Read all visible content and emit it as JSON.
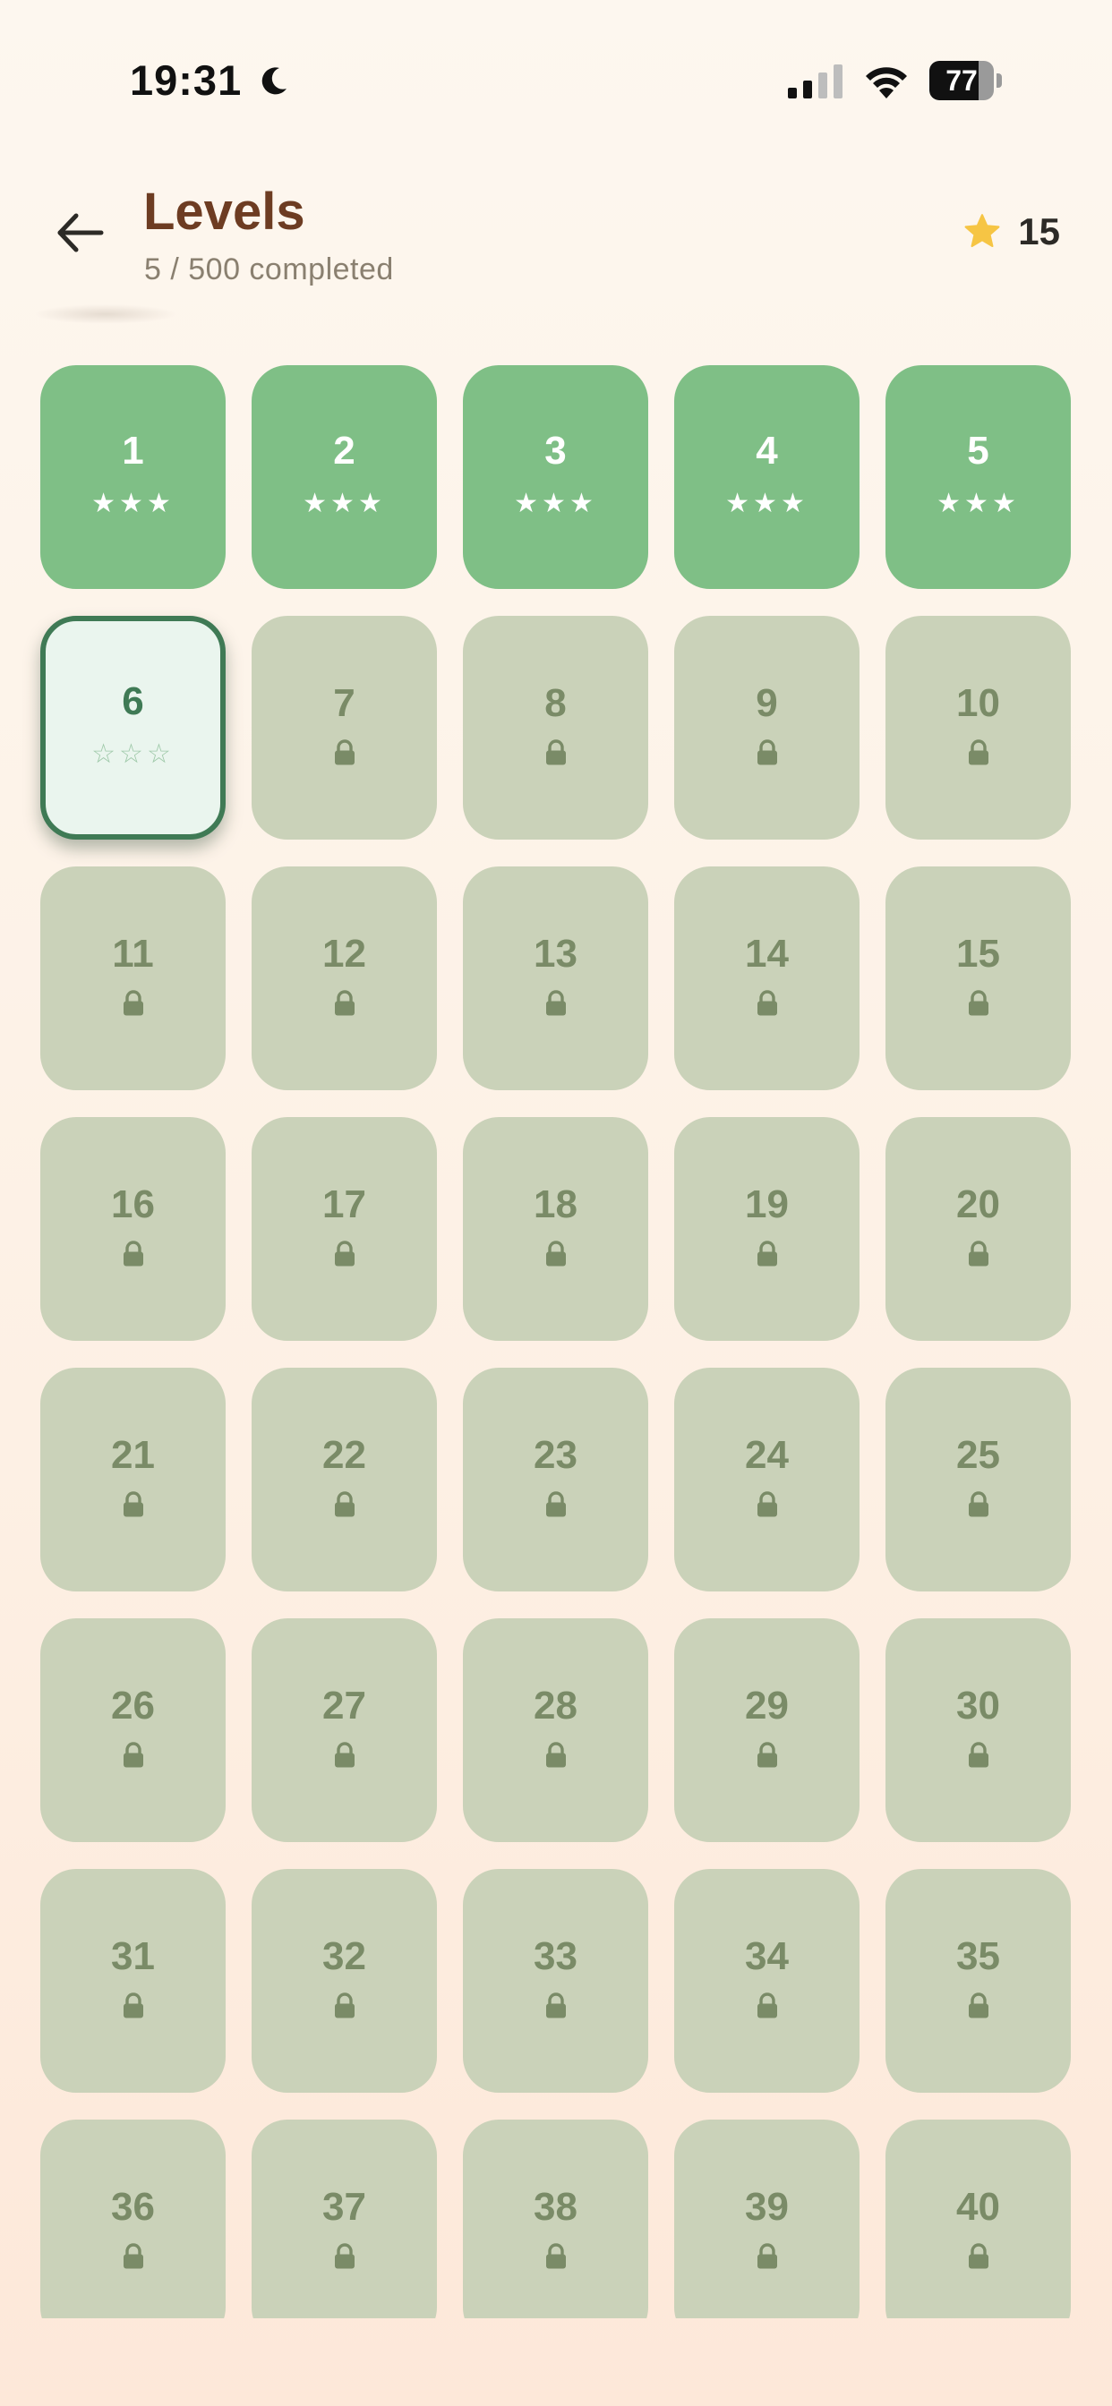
{
  "status_bar": {
    "time": "19:31",
    "battery_level": "77",
    "battery_fraction": 0.77,
    "icons": [
      "moon-icon",
      "signal-icon",
      "wifi-icon",
      "battery-icon"
    ]
  },
  "header": {
    "title": "Levels",
    "subtitle": "5 / 500 completed",
    "star_total": "15",
    "back_icon": "arrow-left-icon",
    "star_icon": "star-icon"
  },
  "colors": {
    "title": "#6d3c22",
    "completed_tile": "#7fbf86",
    "current_tile_bg": "#eaf5ee",
    "current_tile_border": "#3f7a55",
    "locked_tile": "#cad2b9",
    "locked_text": "#7a8b67",
    "star_gold": "#f6c544"
  },
  "levels": [
    {
      "number": "1",
      "state": "completed",
      "stars": "★★★"
    },
    {
      "number": "2",
      "state": "completed",
      "stars": "★★★"
    },
    {
      "number": "3",
      "state": "completed",
      "stars": "★★★"
    },
    {
      "number": "4",
      "state": "completed",
      "stars": "★★★"
    },
    {
      "number": "5",
      "state": "completed",
      "stars": "★★★"
    },
    {
      "number": "6",
      "state": "current",
      "stars": "☆☆☆"
    },
    {
      "number": "7",
      "state": "locked"
    },
    {
      "number": "8",
      "state": "locked"
    },
    {
      "number": "9",
      "state": "locked"
    },
    {
      "number": "10",
      "state": "locked"
    },
    {
      "number": "11",
      "state": "locked"
    },
    {
      "number": "12",
      "state": "locked"
    },
    {
      "number": "13",
      "state": "locked"
    },
    {
      "number": "14",
      "state": "locked"
    },
    {
      "number": "15",
      "state": "locked"
    },
    {
      "number": "16",
      "state": "locked"
    },
    {
      "number": "17",
      "state": "locked"
    },
    {
      "number": "18",
      "state": "locked"
    },
    {
      "number": "19",
      "state": "locked"
    },
    {
      "number": "20",
      "state": "locked"
    },
    {
      "number": "21",
      "state": "locked"
    },
    {
      "number": "22",
      "state": "locked"
    },
    {
      "number": "23",
      "state": "locked"
    },
    {
      "number": "24",
      "state": "locked"
    },
    {
      "number": "25",
      "state": "locked"
    },
    {
      "number": "26",
      "state": "locked"
    },
    {
      "number": "27",
      "state": "locked"
    },
    {
      "number": "28",
      "state": "locked"
    },
    {
      "number": "29",
      "state": "locked"
    },
    {
      "number": "30",
      "state": "locked"
    },
    {
      "number": "31",
      "state": "locked"
    },
    {
      "number": "32",
      "state": "locked"
    },
    {
      "number": "33",
      "state": "locked"
    },
    {
      "number": "34",
      "state": "locked"
    },
    {
      "number": "35",
      "state": "locked"
    },
    {
      "number": "36",
      "state": "locked"
    },
    {
      "number": "37",
      "state": "locked"
    },
    {
      "number": "38",
      "state": "locked"
    },
    {
      "number": "39",
      "state": "locked"
    },
    {
      "number": "40",
      "state": "locked"
    }
  ]
}
